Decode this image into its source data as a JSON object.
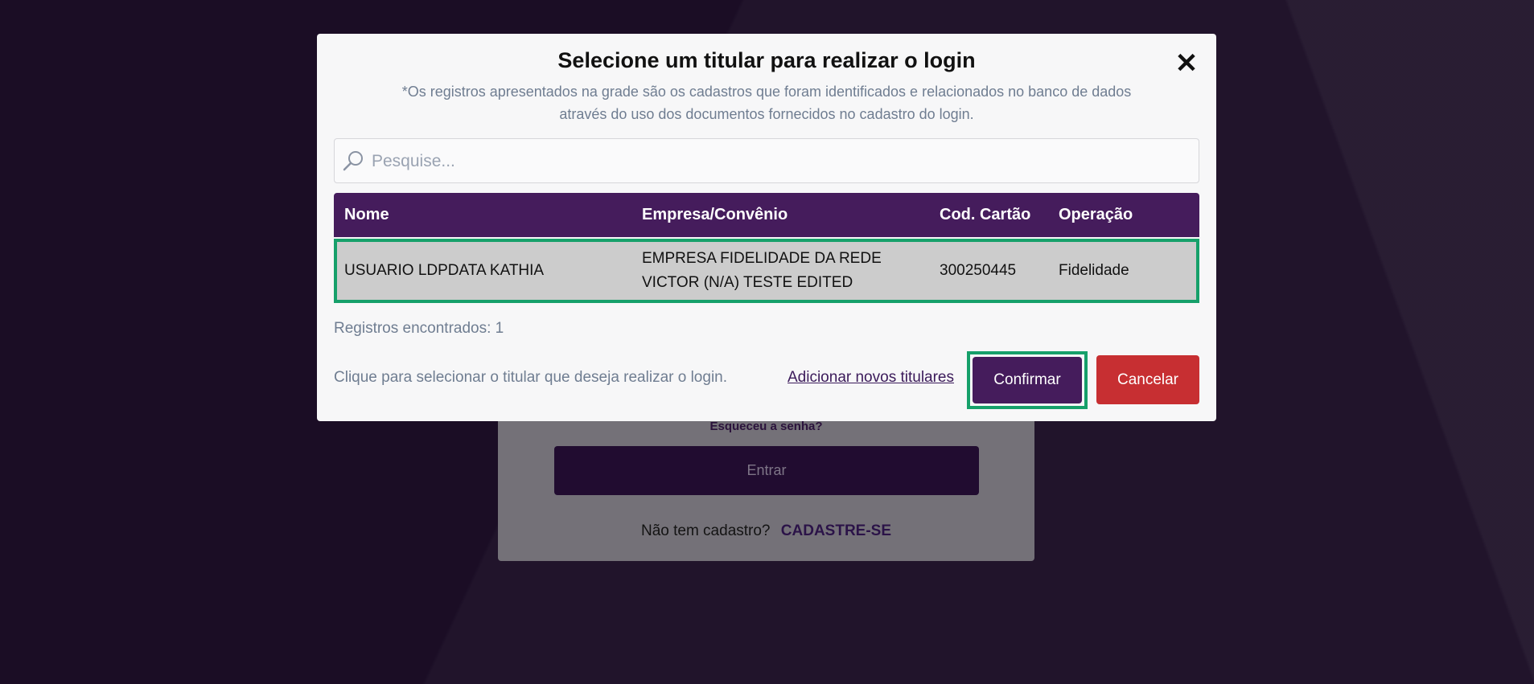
{
  "login": {
    "forgot_password": "Esqueceu a senha?",
    "enter_label": "Entrar",
    "no_account": "Não tem cadastro?",
    "signup_label": "CADASTRE-SE"
  },
  "modal": {
    "title": "Selecione um titular para realizar o login",
    "close_icon": "close-icon",
    "subtitle": "*Os registros apresentados na grade são os cadastros que foram identificados e relacionados no banco de dados através do uso dos documentos fornecidos no cadastro do login.",
    "search": {
      "placeholder": "Pesquise...",
      "icon": "search-icon"
    },
    "table": {
      "headers": [
        "Nome",
        "Empresa/Convênio",
        "Cod. Cartão",
        "Operação"
      ],
      "rows": [
        {
          "nome": "USUARIO LDPDATA KATHIA",
          "empresa_line1": "EMPRESA FIDELIDADE DA REDE",
          "empresa_line2": "VICTOR (N/A) TESTE EDITED",
          "cartao": "300250445",
          "operacao": "Fidelidade"
        }
      ]
    },
    "records_found": "Registros encontrados: 1",
    "hint": "Clique para selecionar o titular que deseja realizar o login.",
    "add_holders_label": "Adicionar novos titulares",
    "confirm_label": "Confirmar",
    "cancel_label": "Cancelar"
  },
  "colors": {
    "primary": "#451c5c",
    "danger": "#c72f32",
    "highlight": "#16a06a",
    "background": "#241232"
  }
}
